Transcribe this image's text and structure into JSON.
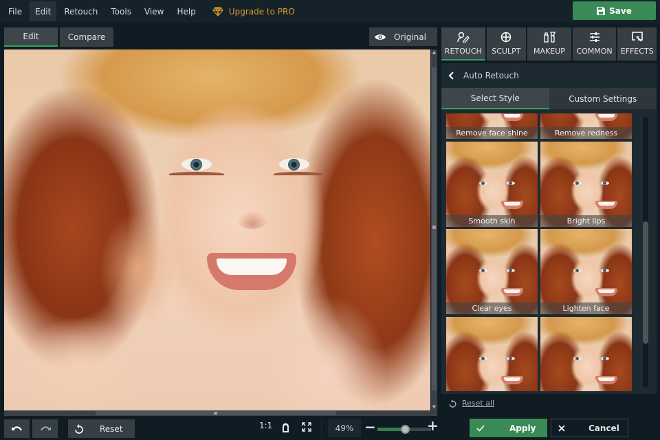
{
  "menubar": {
    "items": [
      {
        "label": "File",
        "active": false
      },
      {
        "label": "Edit",
        "active": true
      },
      {
        "label": "Retouch",
        "active": false
      },
      {
        "label": "Tools",
        "active": false
      },
      {
        "label": "View",
        "active": false
      },
      {
        "label": "Help",
        "active": false
      }
    ],
    "upgrade_label": "Upgrade to PRO",
    "upgrade_icon": "diamond-icon",
    "save_label": "Save",
    "save_icon": "floppy-disk-icon"
  },
  "view_tabs": {
    "edit_label": "Edit",
    "compare_label": "Compare",
    "active": "Edit",
    "original_label": "Original",
    "original_icon": "eye-icon"
  },
  "canvas": {
    "image_description": "Portrait of smiling red-haired woman in straw hat"
  },
  "bottom_toolbar": {
    "undo_icon": "undo-icon",
    "redo_icon": "redo-icon",
    "reset_label": "Reset",
    "actual_size_label": "1:1",
    "zoom_value": "49%",
    "zoom_percent": 49,
    "zoom_out_label": "−",
    "zoom_in_label": "+"
  },
  "panel_tabs": [
    {
      "label": "RETOUCH",
      "icon": "retouch-icon",
      "active": true
    },
    {
      "label": "SCULPT",
      "icon": "sculpt-icon",
      "active": false
    },
    {
      "label": "MAKEUP",
      "icon": "makeup-icon",
      "active": false
    },
    {
      "label": "COMMON",
      "icon": "sliders-icon",
      "active": false
    },
    {
      "label": "EFFECTS",
      "icon": "effects-icon",
      "active": false
    }
  ],
  "panel": {
    "title": "Auto Retouch",
    "back_icon": "chevron-left-icon",
    "subtabs": [
      {
        "label": "Select Style",
        "active": true
      },
      {
        "label": "Custom Settings",
        "active": false
      }
    ],
    "styles": [
      {
        "label": "Remove face shine"
      },
      {
        "label": "Remove redness"
      },
      {
        "label": "Smooth skin"
      },
      {
        "label": "Bright lips"
      },
      {
        "label": "Clear eyes"
      },
      {
        "label": "Lighten face"
      },
      {
        "label": ""
      },
      {
        "label": ""
      }
    ],
    "reset_all_label": "Reset all"
  },
  "actions": {
    "apply_label": "Apply",
    "cancel_label": "Cancel"
  },
  "colors": {
    "accent_green": "#3a8a55",
    "active_underline": "#2fa55a",
    "upgrade_gold": "#d79a2c",
    "background": "#101c24"
  }
}
